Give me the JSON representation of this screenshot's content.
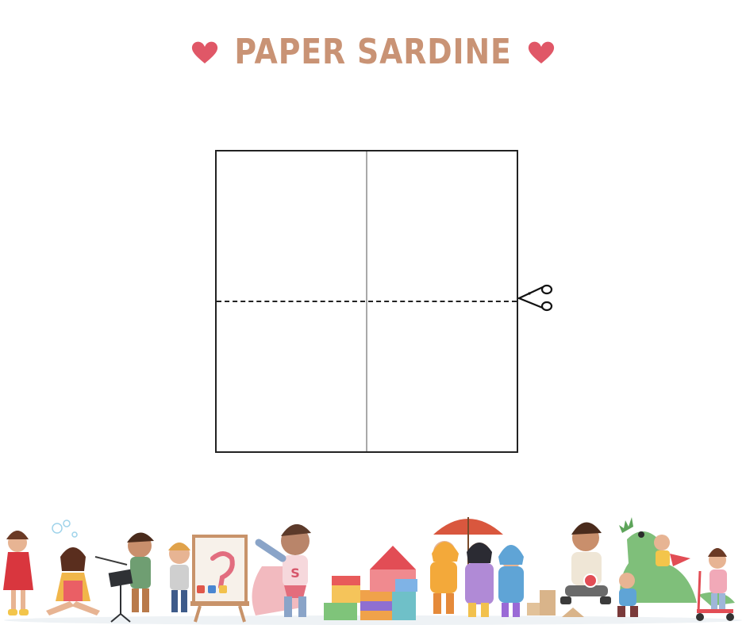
{
  "page": {
    "title": "PAPER SARDINE",
    "icons": {
      "title_left": "heart-icon",
      "title_right": "heart-icon",
      "cut_marker": "scissors-icon"
    }
  },
  "template": {
    "line_styles": {
      "outline": "solid",
      "fold": "solid-gray",
      "cut": "dashed"
    }
  },
  "colors": {
    "title": "#c99375",
    "heart": "#e05767",
    "outline": "#222222",
    "fold_line": "#a9a9a9"
  },
  "decoration": {
    "description_items": [
      "girl-blowing-bubbles",
      "girl-sitting",
      "boy-with-music-stand",
      "child-painting-at-easel",
      "superhero-child",
      "building-blocks",
      "children-under-umbrella",
      "boy-with-blocks",
      "dinosaur-with-children",
      "child-on-scooter"
    ]
  }
}
